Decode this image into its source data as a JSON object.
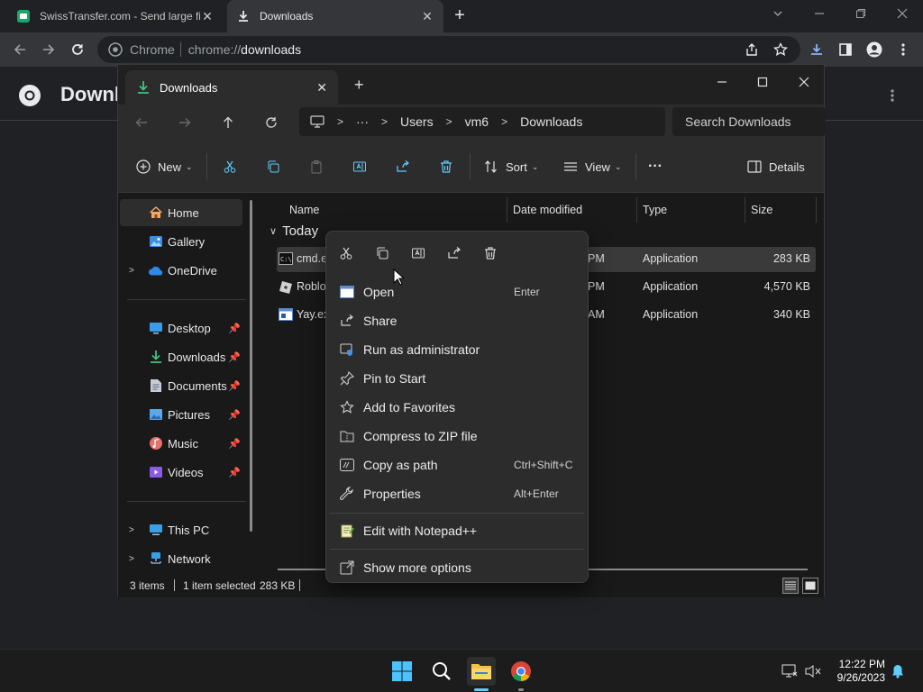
{
  "chrome": {
    "tabs": [
      {
        "title": "SwissTransfer.com - Send large fi",
        "close": "✕"
      },
      {
        "title": "Downloads",
        "close": "✕"
      }
    ],
    "new_tab": "+",
    "omnibox": {
      "site_label": "Chrome",
      "url_prefix": "chrome://",
      "url_path": "downloads"
    },
    "page_title": "Downl"
  },
  "explorer": {
    "tab_title": "Downloads",
    "tab_close": "✕",
    "new_tab": "+",
    "breadcrumb": {
      "more": "···",
      "parts": [
        "Users",
        "vm6",
        "Downloads"
      ]
    },
    "search_placeholder": "Search Downloads",
    "commands": {
      "new": "New",
      "sort": "Sort",
      "view": "View",
      "more": "···",
      "details": "Details"
    },
    "nav": {
      "home": "Home",
      "gallery": "Gallery",
      "onedrive": "OneDrive",
      "desktop": "Desktop",
      "downloads": "Downloads",
      "documents": "Documents",
      "pictures": "Pictures",
      "music": "Music",
      "videos": "Videos",
      "this_pc": "This PC",
      "network": "Network"
    },
    "columns": {
      "name": "Name",
      "date": "Date modified",
      "type": "Type",
      "size": "Size"
    },
    "group": "Today",
    "files": [
      {
        "name": "cmd.e",
        "date": "PM",
        "type": "Application",
        "size": "283 KB"
      },
      {
        "name": "Roblox",
        "date": "PM",
        "type": "Application",
        "size": "4,570 KB"
      },
      {
        "name": "Yay.ex",
        "date": "AM",
        "type": "Application",
        "size": "340 KB"
      }
    ],
    "status": {
      "items": "3 items",
      "selected": "1 item selected",
      "size": "283 KB"
    }
  },
  "context_menu": {
    "quick_actions": [
      "cut-icon",
      "copy-icon",
      "rename-icon",
      "share-icon",
      "delete-icon"
    ],
    "items": [
      {
        "label": "Open",
        "shortcut": "Enter"
      },
      {
        "label": "Share",
        "shortcut": ""
      },
      {
        "label": "Run as administrator",
        "shortcut": ""
      },
      {
        "label": "Pin to Start",
        "shortcut": ""
      },
      {
        "label": "Add to Favorites",
        "shortcut": ""
      },
      {
        "label": "Compress to ZIP file",
        "shortcut": ""
      },
      {
        "label": "Copy as path",
        "shortcut": "Ctrl+Shift+C"
      },
      {
        "label": "Properties",
        "shortcut": "Alt+Enter"
      },
      {
        "label": "Edit with Notepad++",
        "shortcut": ""
      },
      {
        "label": "Show more options",
        "shortcut": ""
      }
    ]
  },
  "taskbar": {
    "time": "12:22 PM",
    "date": "9/26/2023"
  },
  "colors": {
    "accent": "#60cdff",
    "chrome_bg": "#202124",
    "explorer_bg": "#191919",
    "menu_bg": "#2c2c2c"
  }
}
